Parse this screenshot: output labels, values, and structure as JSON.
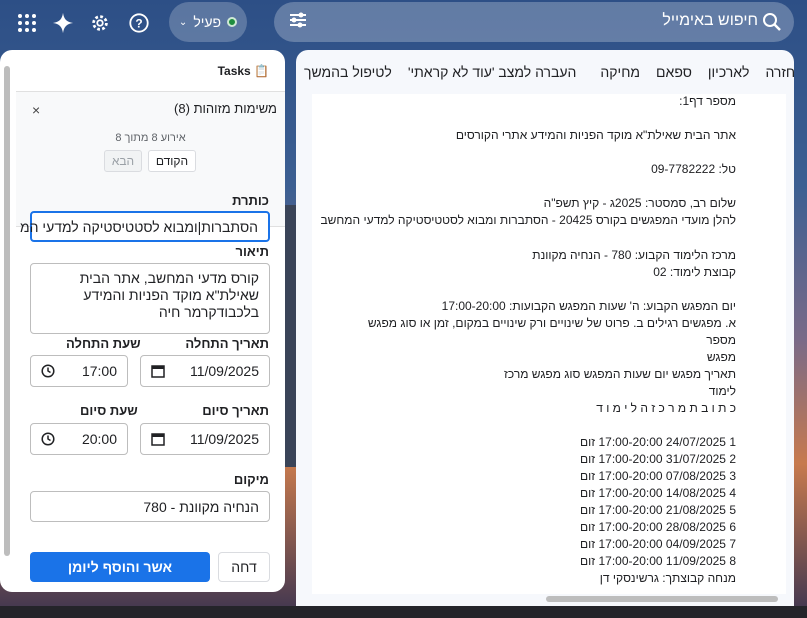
{
  "topbar": {
    "status_label": "פעיל",
    "search_placeholder": "חיפוש באימייל"
  },
  "colors": {
    "accent": "#1a73e8",
    "status_active": "#1e8e3e"
  },
  "tasks_panel": {
    "title": "Tasks 📋",
    "lists_title": "משימות מזוהות (8)",
    "close_label": "×",
    "event_info": "אירוע 8 מתוך 8",
    "prev_label": "הקודם",
    "next_label": "הבא",
    "title_label": "כותרת",
    "title_value": "הסתברות|ומבוא לסטטיסטיקה למדעי המ",
    "description_label": "תיאור",
    "description_value": "קורס מדעי המחשב, אתר הבית שאילת\"א מוקד הפניות והמידע בלכבודקרמר חיה",
    "start_date_label": "תאריך התחלה",
    "start_date_value": "11/09/2025",
    "start_time_label": "שעת התחלה",
    "start_time_value": "17:00",
    "end_date_label": "תאריך סיום",
    "end_date_value": "11/09/2025",
    "end_time_label": "שעת סיום",
    "end_time_value": "20:00",
    "location_label": "מיקום",
    "location_value": "780 - הנחיה מקוונת",
    "confirm_label": "אשר והוסף ליומן",
    "reject_label": "דחה"
  },
  "mail_toolbar": {
    "items": [
      "חזרה",
      "לארכיון",
      "ספאם",
      "מחיקה",
      "העברה למצב 'עוד לא קראתי'",
      "לטיפול בהמשך"
    ]
  },
  "mail_body": {
    "lines": [
      "מספר דף1:",
      "אתר הבית שאילת\"א מוקד הפניות והמידע אתרי הקורסים",
      "טל: 09-7782222",
      "שלום רב, סמסטר: 2025ג - קיץ תשפ\"ה",
      "להלן מועדי המפגשים בקורס 20425 - הסתברות ומבוא לסטטיסטיקה למדעי המחשב",
      "מרכז הלימוד הקבוע: 780 - הנחיה מקוונת",
      "קבוצת לימוד: 02",
      "יום המפגש הקבוע: ה' שעות המפגש הקבועות: 17:00-20:00",
      "א. מפגשים רגילים ב. פרוט של שינויים ורק שינויים במקום, זמן או סוג מפגש",
      "מספר",
      "מפגש",
      "תאריך מפגש יום שעות המפגש סוג מפגש מרכז",
      "לימוד",
      "כ ת ו ב ת מ ר כ ז ה ל י מ ו ד",
      "1 24/07/2025 17:00-20:00 זום",
      "2 31/07/2025 17:00-20:00 זום",
      "3 07/08/2025 17:00-20:00 זום",
      "4 14/08/2025 17:00-20:00 זום",
      "5 21/08/2025 17:00-20:00 זום",
      "6 28/08/2025 17:00-20:00 זום",
      "7 04/09/2025 17:00-20:00 זום",
      "8 11/09/2025 17:00-20:00 זום",
      "מנחה קבוצתך: גרשינסקי דן"
    ]
  }
}
